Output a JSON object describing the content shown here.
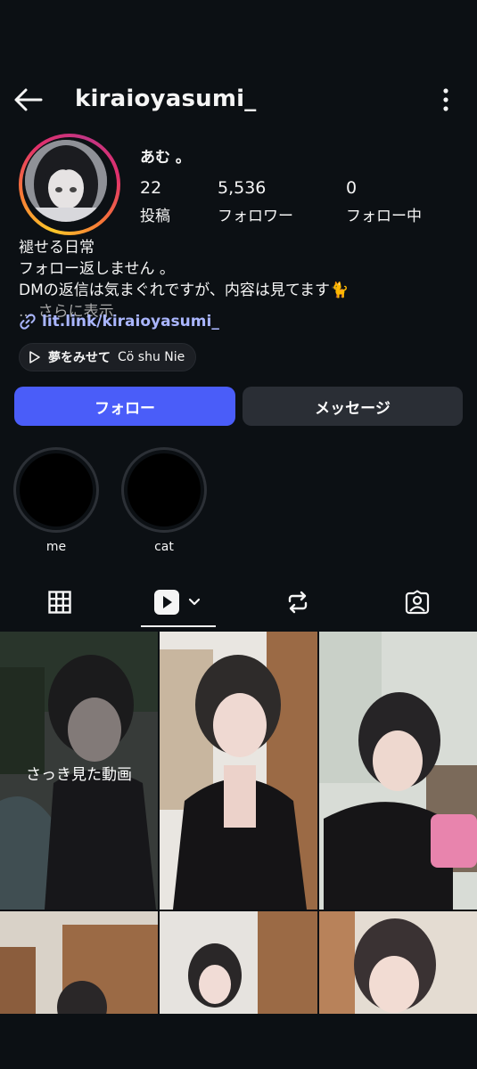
{
  "header": {
    "username": "kiraioyasumi_",
    "back_icon": "arrow-left-icon",
    "menu_icon": "kebab-menu-icon"
  },
  "profile": {
    "display_name": "あむ 。",
    "stats": [
      {
        "value": "22",
        "label": "投稿"
      },
      {
        "value": "5,536",
        "label": "フォロワー"
      },
      {
        "value": "0",
        "label": "フォロー中"
      }
    ],
    "bio_lines": [
      "褪せる日常",
      "フォロー返しません 。",
      "DMの返信は気まぐれですが、内容は見てます🐈"
    ],
    "see_more": "... さらに表示",
    "link": "lit.link/kiraioyasumi_",
    "music": {
      "song": "夢をみせて",
      "artist": "Cö shu Nie"
    }
  },
  "actions": {
    "follow_label": "フォロー",
    "message_label": "メッセージ",
    "follow_color": "#4a5df9"
  },
  "highlights": [
    {
      "label": "me"
    },
    {
      "label": "cat"
    }
  ],
  "tabs": [
    "grid-icon",
    "reels-icon",
    "reposts-icon",
    "tagged-icon"
  ],
  "grid": {
    "recent_caption": "さっき見た動画"
  }
}
